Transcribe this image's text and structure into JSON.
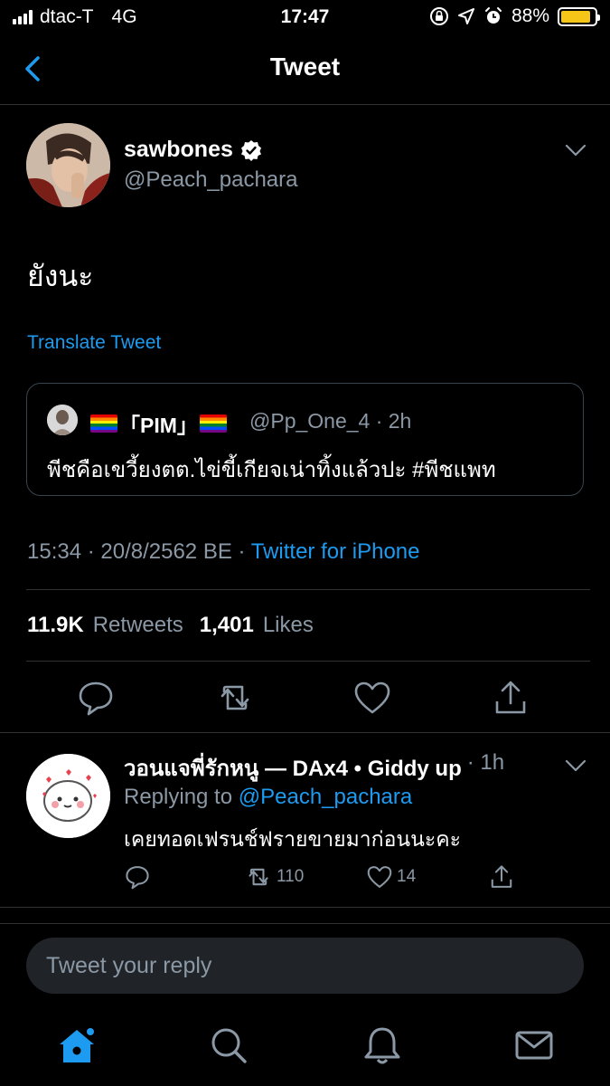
{
  "status_bar": {
    "carrier": "dtac-T",
    "network": "4G",
    "time": "17:47",
    "battery": "88%",
    "battery_level": 0.88,
    "icons": [
      "signal-icon",
      "rotation-lock-icon",
      "location-icon",
      "alarm-icon",
      "battery-icon"
    ]
  },
  "nav": {
    "title": "Tweet",
    "back_icon": "chevron-left-icon"
  },
  "tweet": {
    "author_name": "sawbones",
    "verified": true,
    "handle": "@Peach_pachara",
    "text": "ยังนะ",
    "translate_label": "Translate Tweet",
    "timestamp": "15:34 · 20/8/2562 BE · ",
    "source": "Twitter for iPhone",
    "retweets_count": "11.9K",
    "retweets_label": "Retweets",
    "likes_count": "1,401",
    "likes_label": "Likes",
    "quote": {
      "name": "「PIM」",
      "meta": "@Pp_One_4 · 2h",
      "text": "พีชคือเขวี้ยงตต.ไข่ขี้เกียจเน่าทิ้งแล้วปะ #พีชแพท"
    }
  },
  "reply": {
    "name": "วอนแจพี่รักหนู — DAx4 • Giddy up",
    "time": "· 1h",
    "replying_prefix": "Replying to ",
    "replying_handle": "@Peach_pachara",
    "text": "เคยทอดเฟรนช์ฟรายขายมาก่อนนะคะ",
    "retweets": "110",
    "likes": "14"
  },
  "compose": {
    "placeholder": "Tweet your reply"
  },
  "colors": {
    "accent": "#1d9bf0",
    "muted": "#8b98a5",
    "background": "#000000",
    "battery": "#f5c518"
  }
}
